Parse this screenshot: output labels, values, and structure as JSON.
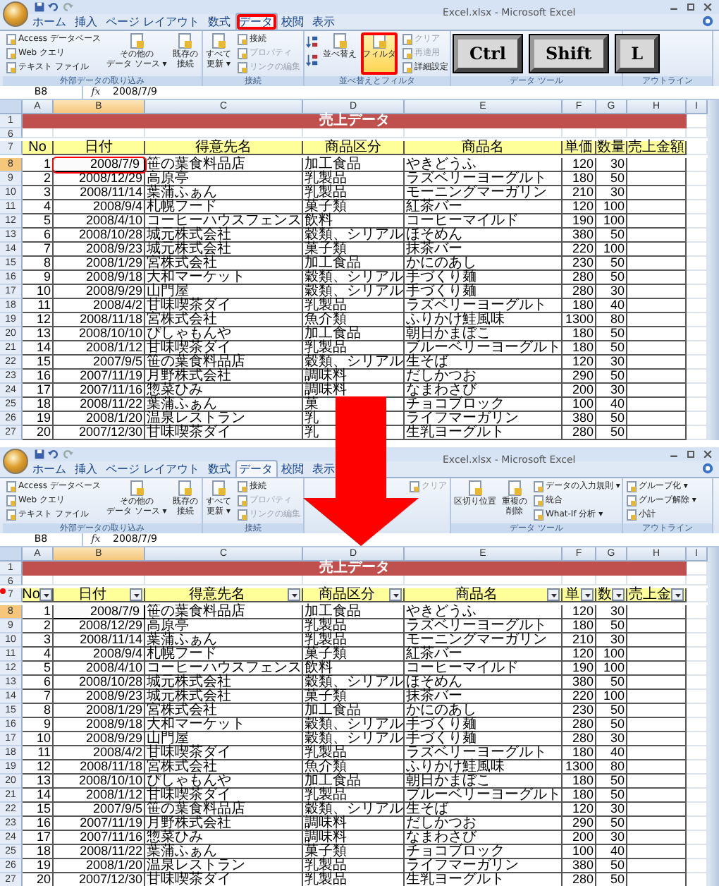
{
  "panels": [
    {
      "title": "Excel.xlsx - Microsoft Excel",
      "tabs": [
        {
          "label": "ホーム",
          "selected": false,
          "highlighted": false
        },
        {
          "label": "挿入",
          "selected": false,
          "highlighted": false
        },
        {
          "label": "ページ レイアウト",
          "selected": false,
          "highlighted": false
        },
        {
          "label": "数式",
          "selected": false,
          "highlighted": false
        },
        {
          "label": "データ",
          "selected": true,
          "highlighted": true
        },
        {
          "label": "校閲",
          "selected": false,
          "highlighted": false
        },
        {
          "label": "表示",
          "selected": false,
          "highlighted": false
        }
      ],
      "ribbon": [
        {
          "label": "外部データの取り込み",
          "items": [
            {
              "kind": "small",
              "text": "Access データベース",
              "disabled": false,
              "active": false,
              "highlighted": false
            },
            {
              "kind": "small",
              "text": "Web クエリ",
              "disabled": false,
              "active": false,
              "highlighted": false
            },
            {
              "kind": "small",
              "text": "テキスト ファイル",
              "disabled": false,
              "active": false,
              "highlighted": false
            },
            {
              "kind": "large",
              "lines": [
                "その他の",
                "データ ソース ▾"
              ],
              "disabled": false,
              "active": false,
              "highlighted": false
            },
            {
              "kind": "large",
              "lines": [
                "既存の",
                "接続"
              ],
              "disabled": false,
              "active": false,
              "highlighted": false
            }
          ]
        },
        {
          "label": "接続",
          "items": [
            {
              "kind": "large",
              "lines": [
                "すべて",
                "更新 ▾"
              ],
              "disabled": false,
              "active": false,
              "highlighted": false
            },
            {
              "kind": "small",
              "text": "接続",
              "disabled": false,
              "active": false,
              "highlighted": false
            },
            {
              "kind": "small",
              "text": "プロパティ",
              "disabled": true,
              "active": false,
              "highlighted": false
            },
            {
              "kind": "small",
              "text": "リンクの編集",
              "disabled": true,
              "active": false,
              "highlighted": false
            }
          ]
        },
        {
          "label": "並べ替えとフィルタ",
          "items": [
            {
              "kind": "sort"
            },
            {
              "kind": "large",
              "lines": [
                "並べ替え"
              ],
              "disabled": false,
              "active": false,
              "highlighted": false
            },
            {
              "kind": "large",
              "lines": [
                "フィルタ"
              ],
              "disabled": false,
              "active": true,
              "highlighted": true
            },
            {
              "kind": "small",
              "text": "クリア",
              "disabled": true,
              "active": false,
              "highlighted": false
            },
            {
              "kind": "small",
              "text": "再適用",
              "disabled": true,
              "active": false,
              "highlighted": false
            },
            {
              "kind": "small",
              "text": "詳細設定",
              "disabled": false,
              "active": false,
              "highlighted": false
            }
          ]
        },
        {
          "label": "データ ツール"
        },
        {
          "label": "アウトライン"
        }
      ],
      "name_box": "B8",
      "formula_icon": "fx",
      "formula": "2008/7/9",
      "columns": [
        {
          "label": "A",
          "selected": false
        },
        {
          "label": "B",
          "selected": true
        },
        {
          "label": "C",
          "selected": false
        },
        {
          "label": "D",
          "selected": false
        },
        {
          "label": "E",
          "selected": false
        },
        {
          "label": "F",
          "selected": false
        },
        {
          "label": "G",
          "selected": false
        },
        {
          "label": "H",
          "selected": false
        },
        {
          "label": "I",
          "selected": false
        }
      ],
      "title_row": "1",
      "sheet_title": "売上データ",
      "blank_row": "6",
      "header_row": "7",
      "headers": [
        "No",
        "日付",
        "得意先名",
        "商品区分",
        "商品名",
        "単価",
        "数量",
        "売上金額"
      ],
      "filter_on": false,
      "header_highlighted": false,
      "active_cell_highlighted": true,
      "rows": [
        {
          "number": "8",
          "selected": true,
          "cells": [
            "1",
            "2008/7/9",
            "笹の葉食料品店",
            "加工食品",
            "やきどうふ",
            "120",
            "30"
          ]
        },
        {
          "number": "9",
          "selected": false,
          "cells": [
            "2",
            "2008/12/29",
            "高原亭",
            "乳製品",
            "ラズベリーヨーグルト",
            "180",
            "50"
          ]
        },
        {
          "number": "10",
          "selected": false,
          "cells": [
            "3",
            "2008/11/14",
            "葉蒲ふぁん",
            "乳製品",
            "モーニングマーガリン",
            "210",
            "30"
          ]
        },
        {
          "number": "11",
          "selected": false,
          "cells": [
            "4",
            "2008/9/4",
            "札幌フード",
            "菓子類",
            "紅茶バー",
            "120",
            "100"
          ]
        },
        {
          "number": "12",
          "selected": false,
          "cells": [
            "5",
            "2008/4/10",
            "コーヒーハウスフェンス",
            "飲料",
            "コーヒーマイルド",
            "190",
            "100"
          ]
        },
        {
          "number": "13",
          "selected": false,
          "cells": [
            "6",
            "2008/10/28",
            "城元株式会社",
            "穀類、シリアル",
            "ほそめん",
            "380",
            "50"
          ]
        },
        {
          "number": "14",
          "selected": false,
          "cells": [
            "7",
            "2008/9/23",
            "城元株式会社",
            "菓子類",
            "抹茶バー",
            "220",
            "100"
          ]
        },
        {
          "number": "15",
          "selected": false,
          "cells": [
            "8",
            "2008/1/29",
            "宮株式会社",
            "加工食品",
            "かにのあし",
            "230",
            "50"
          ]
        },
        {
          "number": "16",
          "selected": false,
          "cells": [
            "9",
            "2008/9/18",
            "大和マーケット",
            "穀類、シリアル",
            "手づくり麺",
            "280",
            "50"
          ]
        },
        {
          "number": "17",
          "selected": false,
          "cells": [
            "10",
            "2008/9/29",
            "山門屋",
            "穀類、シリアル",
            "手づくり麺",
            "280",
            "30"
          ]
        },
        {
          "number": "18",
          "selected": false,
          "cells": [
            "11",
            "2008/4/2",
            "甘味喫茶ダイ",
            "乳製品",
            "ラズベリーヨーグルト",
            "180",
            "40"
          ]
        },
        {
          "number": "19",
          "selected": false,
          "cells": [
            "12",
            "2008/11/18",
            "宮株式会社",
            "魚介類",
            "ふりかけ鮭風味",
            "1300",
            "80"
          ]
        },
        {
          "number": "20",
          "selected": false,
          "cells": [
            "13",
            "2008/10/10",
            "ぴしゃもんや",
            "加工食品",
            "朝日かまぼこ",
            "180",
            "50"
          ]
        },
        {
          "number": "21",
          "selected": false,
          "cells": [
            "14",
            "2008/1/12",
            "甘味喫茶ダイ",
            "乳製品",
            "ブルーベリーヨーグルト",
            "180",
            "50"
          ]
        },
        {
          "number": "22",
          "selected": false,
          "cells": [
            "15",
            "2007/9/5",
            "笹の葉食料品店",
            "穀類、シリアル",
            "生そば",
            "120",
            "30"
          ]
        },
        {
          "number": "23",
          "selected": false,
          "cells": [
            "16",
            "2007/11/19",
            "月野株式会社",
            "調味料",
            "だしかつお",
            "290",
            "50"
          ]
        },
        {
          "number": "24",
          "selected": false,
          "cells": [
            "17",
            "2007/11/16",
            "惣菜ひみ",
            "調味料",
            "なまわさび",
            "200",
            "30"
          ]
        },
        {
          "number": "25",
          "selected": false,
          "cells": [
            "18",
            "2008/11/22",
            "葉蒲ふぁん",
            "菓",
            "チョコブロック",
            "100",
            "40"
          ]
        },
        {
          "number": "26",
          "selected": false,
          "cells": [
            "19",
            "2008/1/20",
            "温泉レストラン",
            "乳",
            "ライフマーガリン",
            "380",
            "50"
          ]
        },
        {
          "number": "27",
          "selected": false,
          "cells": [
            "20",
            "2007/12/30",
            "甘味喫茶ダイ",
            "乳",
            "生乳ヨーグルト",
            "280",
            "50"
          ]
        }
      ]
    },
    {
      "title": "Excel.xlsx - Microsoft Excel",
      "tabs": [
        {
          "label": "ホーム",
          "selected": false,
          "highlighted": false
        },
        {
          "label": "挿入",
          "selected": false,
          "highlighted": false
        },
        {
          "label": "ページ レイアウト",
          "selected": false,
          "highlighted": false
        },
        {
          "label": "数式",
          "selected": false,
          "highlighted": false
        },
        {
          "label": "データ",
          "selected": true,
          "highlighted": false
        },
        {
          "label": "校閲",
          "selected": false,
          "highlighted": false
        },
        {
          "label": "表示",
          "selected": false,
          "highlighted": false
        }
      ],
      "ribbon": [
        {
          "label": "外部データの取り込み",
          "items": [
            {
              "kind": "small",
              "text": "Access データベース",
              "disabled": false,
              "active": false,
              "highlighted": false
            },
            {
              "kind": "small",
              "text": "Web クエリ",
              "disabled": false,
              "active": false,
              "highlighted": false
            },
            {
              "kind": "small",
              "text": "テキスト ファイル",
              "disabled": false,
              "active": false,
              "highlighted": false
            },
            {
              "kind": "large",
              "lines": [
                "その他の",
                "データ ソース ▾"
              ],
              "disabled": false,
              "active": false,
              "highlighted": false
            },
            {
              "kind": "large",
              "lines": [
                "既存の",
                "接続"
              ],
              "disabled": false,
              "active": false,
              "highlighted": false
            }
          ]
        },
        {
          "label": "接続",
          "items": [
            {
              "kind": "large",
              "lines": [
                "すべて",
                "更新 ▾"
              ],
              "disabled": false,
              "active": false,
              "highlighted": false
            },
            {
              "kind": "small",
              "text": "接続",
              "disabled": false,
              "active": false,
              "highlighted": false
            },
            {
              "kind": "small",
              "text": "プロパティ",
              "disabled": true,
              "active": false,
              "highlighted": false
            },
            {
              "kind": "small",
              "text": "リンクの編集",
              "disabled": true,
              "active": false,
              "highlighted": false
            }
          ]
        },
        {
          "items": [
            {
              "kind": "small",
              "text": "クリア",
              "disabled": true,
              "active": false,
              "highlighted": false
            }
          ]
        },
        {
          "label": "データ ツール",
          "items": [
            {
              "kind": "large",
              "lines": [
                "区切り位置"
              ],
              "disabled": false,
              "active": false,
              "highlighted": false
            },
            {
              "kind": "large",
              "lines": [
                "重複の",
                "削除"
              ],
              "disabled": false,
              "active": false,
              "highlighted": false
            },
            {
              "kind": "small",
              "text": "データの入力規則 ▾",
              "disabled": false,
              "active": false,
              "highlighted": false
            },
            {
              "kind": "small",
              "text": "統合",
              "disabled": false,
              "active": false,
              "highlighted": false
            },
            {
              "kind": "small",
              "text": "What-If 分析 ▾",
              "disabled": false,
              "active": false,
              "highlighted": false
            }
          ]
        },
        {
          "label": "アウトライン",
          "items": [
            {
              "kind": "small",
              "text": "グループ化 ▾",
              "disabled": false,
              "active": false,
              "highlighted": false
            },
            {
              "kind": "small",
              "text": "グループ解除 ▾",
              "disabled": false,
              "active": false,
              "highlighted": false
            },
            {
              "kind": "small",
              "text": "小計",
              "disabled": false,
              "active": false,
              "highlighted": false
            }
          ]
        }
      ],
      "name_box": "B8",
      "formula_icon": "fx",
      "formula": "2008/7/9",
      "columns": [
        {
          "label": "A",
          "selected": false
        },
        {
          "label": "B",
          "selected": true
        },
        {
          "label": "C",
          "selected": false
        },
        {
          "label": "D",
          "selected": false
        },
        {
          "label": "E",
          "selected": false
        },
        {
          "label": "F",
          "selected": false
        },
        {
          "label": "G",
          "selected": false
        },
        {
          "label": "H",
          "selected": false
        },
        {
          "label": "I",
          "selected": false
        }
      ],
      "title_row": "1",
      "sheet_title": "売上データ",
      "blank_row": "6",
      "header_row": "7",
      "headers": [
        "No",
        "日付",
        "得意先名",
        "商品区分",
        "商品名",
        "単",
        "数",
        "売上金"
      ],
      "filter_on": true,
      "header_highlighted": true,
      "active_cell_highlighted": false,
      "rows": [
        {
          "number": "8",
          "selected": true,
          "cells": [
            "1",
            "2008/7/9",
            "笹の葉食料品店",
            "加工食品",
            "やきどうふ",
            "120",
            "30"
          ]
        },
        {
          "number": "9",
          "selected": false,
          "cells": [
            "2",
            "2008/12/29",
            "高原亭",
            "乳製品",
            "ラズベリーヨーグルト",
            "180",
            "50"
          ]
        },
        {
          "number": "10",
          "selected": false,
          "cells": [
            "3",
            "2008/11/14",
            "葉蒲ふぁん",
            "乳製品",
            "モーニングマーガリン",
            "210",
            "30"
          ]
        },
        {
          "number": "11",
          "selected": false,
          "cells": [
            "4",
            "2008/9/4",
            "札幌フード",
            "菓子類",
            "紅茶バー",
            "120",
            "100"
          ]
        },
        {
          "number": "12",
          "selected": false,
          "cells": [
            "5",
            "2008/4/10",
            "コーヒーハウスフェンス",
            "飲料",
            "コーヒーマイルド",
            "190",
            "100"
          ]
        },
        {
          "number": "13",
          "selected": false,
          "cells": [
            "6",
            "2008/10/28",
            "城元株式会社",
            "穀類、シリアル",
            "ほそめん",
            "380",
            "50"
          ]
        },
        {
          "number": "14",
          "selected": false,
          "cells": [
            "7",
            "2008/9/23",
            "城元株式会社",
            "菓子類",
            "抹茶バー",
            "220",
            "100"
          ]
        },
        {
          "number": "15",
          "selected": false,
          "cells": [
            "8",
            "2008/1/29",
            "宮株式会社",
            "加工食品",
            "かにのあし",
            "230",
            "50"
          ]
        },
        {
          "number": "16",
          "selected": false,
          "cells": [
            "9",
            "2008/9/18",
            "大和マーケット",
            "穀類、シリアル",
            "手づくり麺",
            "280",
            "50"
          ]
        },
        {
          "number": "17",
          "selected": false,
          "cells": [
            "10",
            "2008/9/29",
            "山門屋",
            "穀類、シリアル",
            "手づくり麺",
            "280",
            "30"
          ]
        },
        {
          "number": "18",
          "selected": false,
          "cells": [
            "11",
            "2008/4/2",
            "甘味喫茶ダイ",
            "乳製品",
            "ラズベリーヨーグルト",
            "180",
            "40"
          ]
        },
        {
          "number": "19",
          "selected": false,
          "cells": [
            "12",
            "2008/11/18",
            "宮株式会社",
            "魚介類",
            "ふりかけ鮭風味",
            "1300",
            "80"
          ]
        },
        {
          "number": "20",
          "selected": false,
          "cells": [
            "13",
            "2008/10/10",
            "ぴしゃもんや",
            "加工食品",
            "朝日かまぼこ",
            "180",
            "50"
          ]
        },
        {
          "number": "21",
          "selected": false,
          "cells": [
            "14",
            "2008/1/12",
            "甘味喫茶ダイ",
            "乳製品",
            "ブルーベリーヨーグルト",
            "180",
            "50"
          ]
        },
        {
          "number": "22",
          "selected": false,
          "cells": [
            "15",
            "2007/9/5",
            "笹の葉食料品店",
            "穀類、シリアル",
            "生そば",
            "120",
            "30"
          ]
        },
        {
          "number": "23",
          "selected": false,
          "cells": [
            "16",
            "2007/11/19",
            "月野株式会社",
            "調味料",
            "だしかつお",
            "290",
            "50"
          ]
        },
        {
          "number": "24",
          "selected": false,
          "cells": [
            "17",
            "2007/11/16",
            "惣菜ひみ",
            "調味料",
            "なまわさび",
            "200",
            "30"
          ]
        },
        {
          "number": "25",
          "selected": false,
          "cells": [
            "18",
            "2008/11/22",
            "葉蒲ふぁん",
            "菓子類",
            "チョコブロック",
            "100",
            "40"
          ]
        },
        {
          "number": "26",
          "selected": false,
          "cells": [
            "19",
            "2008/1/20",
            "温泉レストラン",
            "乳製品",
            "ライフマーガリン",
            "380",
            "50"
          ]
        },
        {
          "number": "27",
          "selected": false,
          "cells": [
            "20",
            "2007/12/30",
            "甘味喫茶ダイ",
            "乳製品",
            "生乳ヨーグルト",
            "280",
            "50"
          ]
        }
      ]
    }
  ],
  "keys": [
    "Ctrl",
    "Shift",
    "L"
  ]
}
